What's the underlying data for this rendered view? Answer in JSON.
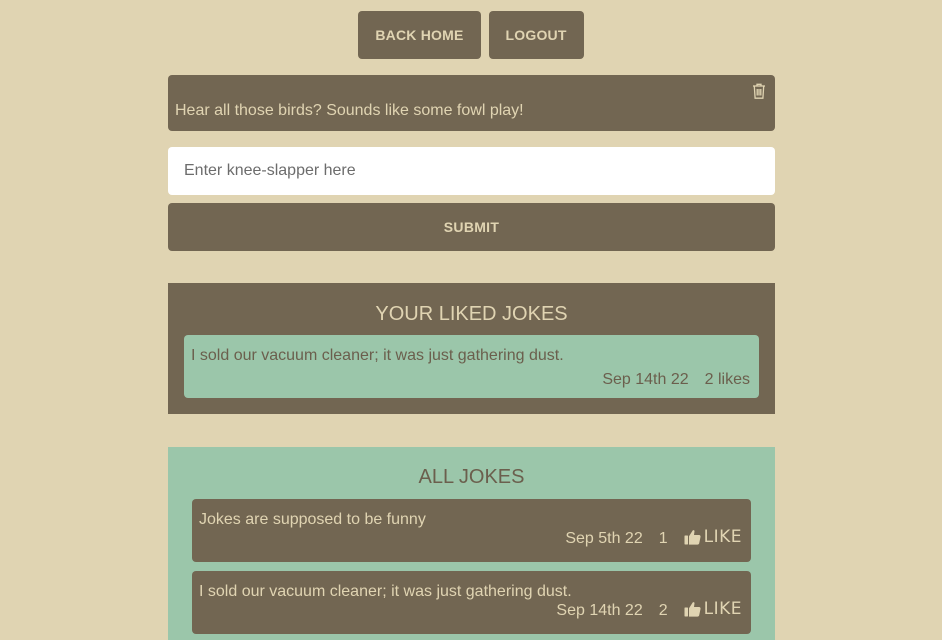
{
  "nav": {
    "back_home_label": "BACK HOME",
    "logout_label": "LOGOUT"
  },
  "my_joke": {
    "text": "Hear all those birds? Sounds like some fowl play!",
    "delete_icon": "trash-icon"
  },
  "joke_form": {
    "placeholder": "Enter knee-slapper here",
    "value": "",
    "submit_label": "SUBMIT"
  },
  "liked_jokes": {
    "title": "YOUR LIKED JOKES",
    "items": [
      {
        "text": "I sold our vacuum cleaner; it was just gathering dust.",
        "date": "Sep 14th 22",
        "likes": "2 likes"
      }
    ]
  },
  "all_jokes": {
    "title": "ALL JOKES",
    "like_label": "LIKE",
    "like_icon": "thumbs-up-icon",
    "items": [
      {
        "text": "Jokes are supposed to be funny",
        "date": "Sep 5th 22",
        "count": "1"
      },
      {
        "text": "I sold our vacuum cleaner; it was just gathering dust.",
        "date": "Sep 14th 22",
        "count": "2"
      }
    ]
  },
  "colors": {
    "background": "#e0d4b2",
    "dark": "#726652",
    "green": "#9bc6aa"
  }
}
